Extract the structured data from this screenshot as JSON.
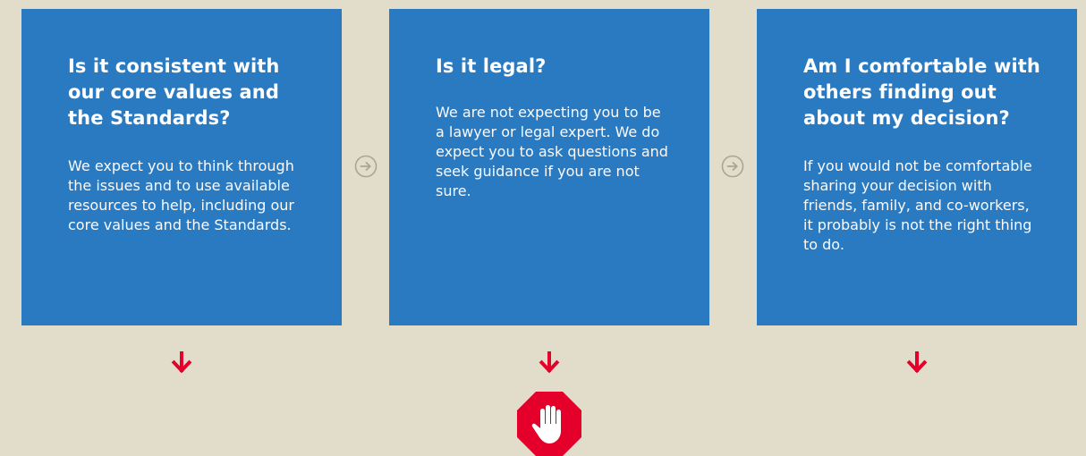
{
  "cards": [
    {
      "title": "Is it consistent with our core values and the Standards?",
      "body": "We expect you to think through the issues and to use available resources to help, including our core values and the Standards."
    },
    {
      "title": "Is it legal?",
      "body": "We are not expecting you to be a lawyer or legal expert. We do expect you to ask questions and seek guidance if you are not sure."
    },
    {
      "title": "Am I comfortable with others finding out about my decision?",
      "body": "If you would not be comfortable sharing your decision with friends, family, and co-workers, it probably is not the right thing to do."
    }
  ],
  "icons": {
    "next": "arrow-circle-right-icon",
    "down": "arrow-down-icon",
    "stop": "stop-hand-icon"
  },
  "colors": {
    "background": "#e2dccb",
    "card": "#2a7ac2",
    "card_text": "#ffffff",
    "connector": "#a9a596",
    "alert": "#e4002b"
  }
}
